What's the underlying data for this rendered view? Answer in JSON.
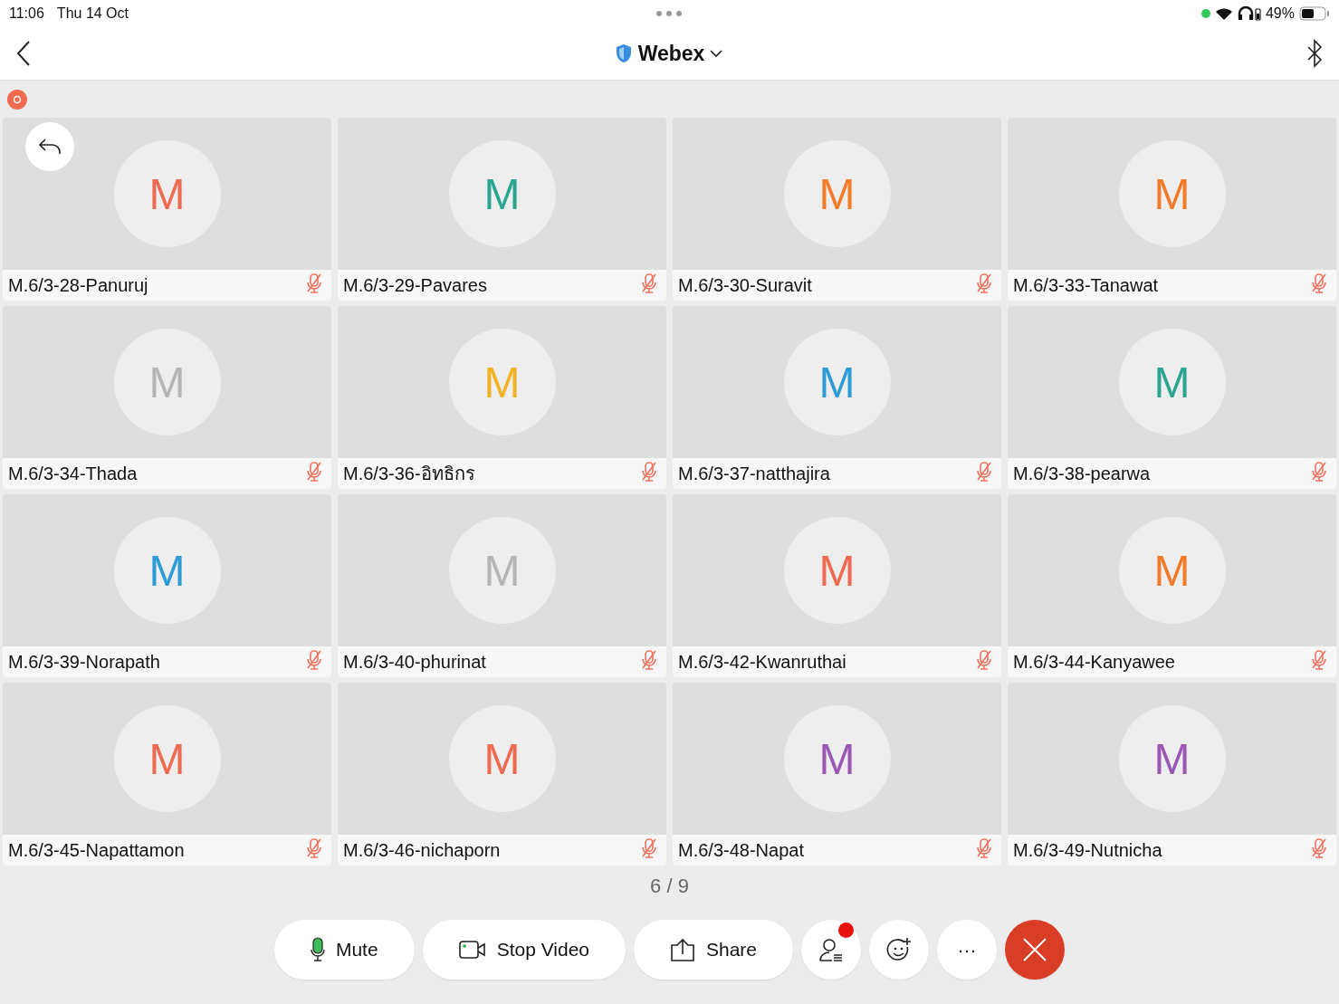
{
  "status_bar": {
    "time": "11:06",
    "date": "Thu 14 Oct",
    "battery": "49%"
  },
  "nav": {
    "title": "Webex"
  },
  "recording": true,
  "participants": [
    {
      "initial": "M",
      "color": "#f06a50",
      "name": "M.6/3-28-Panuruj",
      "muted": true
    },
    {
      "initial": "M",
      "color": "#2aa58f",
      "name": "M.6/3-29-Pavares",
      "muted": true
    },
    {
      "initial": "M",
      "color": "#f47b2a",
      "name": "M.6/3-30-Suravit",
      "muted": true
    },
    {
      "initial": "M",
      "color": "#f47b2a",
      "name": "M.6/3-33-Tanawat",
      "muted": true
    },
    {
      "initial": "M",
      "color": "#b5b5b5",
      "name": "M.6/3-34-Thada",
      "muted": true
    },
    {
      "initial": "M",
      "color": "#f0b323",
      "name": "M.6/3-36-อิทธิกร",
      "muted": true
    },
    {
      "initial": "M",
      "color": "#2d9bd6",
      "name": "M.6/3-37-natthajira",
      "muted": true
    },
    {
      "initial": "M",
      "color": "#2aa58f",
      "name": "M.6/3-38-pearwa",
      "muted": true
    },
    {
      "initial": "M",
      "color": "#2d9bd6",
      "name": "M.6/3-39-Norapath",
      "muted": true
    },
    {
      "initial": "M",
      "color": "#b5b5b5",
      "name": "M.6/3-40-phurinat",
      "muted": true
    },
    {
      "initial": "M",
      "color": "#f06a50",
      "name": "M.6/3-42-Kwanruthai",
      "muted": true
    },
    {
      "initial": "M",
      "color": "#f47b2a",
      "name": "M.6/3-44-Kanyawee",
      "muted": true
    },
    {
      "initial": "M",
      "color": "#f06a50",
      "name": "M.6/3-45-Napattamon",
      "muted": true
    },
    {
      "initial": "M",
      "color": "#f06a50",
      "name": "M.6/3-46-nichaporn",
      "muted": true
    },
    {
      "initial": "M",
      "color": "#9a57b5",
      "name": "M.6/3-48-Napat",
      "muted": true
    },
    {
      "initial": "M",
      "color": "#9a57b5",
      "name": "M.6/3-49-Nutnicha",
      "muted": true
    }
  ],
  "page_indicator": "6 / 9",
  "toolbar": [
    {
      "kind": "mute",
      "label": "Mute"
    },
    {
      "kind": "video",
      "label": "Stop Video"
    },
    {
      "kind": "share",
      "label": "Share"
    },
    {
      "kind": "participants",
      "notification": true
    },
    {
      "kind": "reactions"
    },
    {
      "kind": "more",
      "label": "···"
    },
    {
      "kind": "leave"
    }
  ]
}
